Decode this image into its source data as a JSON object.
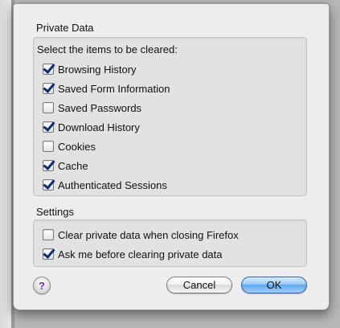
{
  "dialog": {
    "private_data_title": "Private Data",
    "instructions": "Select the items to be cleared:",
    "items": [
      {
        "label": "Browsing History",
        "checked": true
      },
      {
        "label": "Saved Form Information",
        "checked": true
      },
      {
        "label": "Saved Passwords",
        "checked": false
      },
      {
        "label": "Download History",
        "checked": true
      },
      {
        "label": "Cookies",
        "checked": false
      },
      {
        "label": "Cache",
        "checked": true
      },
      {
        "label": "Authenticated Sessions",
        "checked": true
      }
    ],
    "settings_title": "Settings",
    "settings": [
      {
        "label": "Clear private data when closing Firefox",
        "checked": false
      },
      {
        "label": "Ask me before clearing private data",
        "checked": true
      }
    ],
    "help_label": "?",
    "cancel_label": "Cancel",
    "ok_label": "OK"
  },
  "colors": {
    "checkmark": "#0f2c74",
    "default_button": "#5fa6ec",
    "help_icon": "#6b2bb5"
  }
}
